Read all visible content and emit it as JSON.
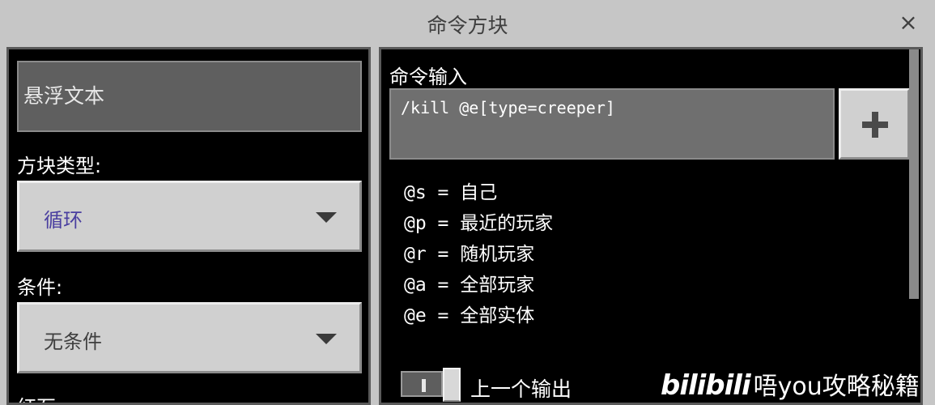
{
  "window": {
    "title": "命令方块",
    "close_label": "×"
  },
  "left_panel": {
    "hover_text_placeholder": "悬浮文本",
    "block_type_label": "方块类型:",
    "block_type_value": "循环",
    "conditional_label": "条件:",
    "conditional_value": "无条件",
    "redstone_label": "红石:"
  },
  "right_panel": {
    "command_input_label": "命令输入",
    "command_value": "/kill @e[type=creeper]",
    "add_button_icon": "plus-icon",
    "selectors": [
      "@s = 自己",
      "@p = 最近的玩家",
      "@r = 随机玩家",
      "@a = 全部玩家",
      "@e = 全部实体"
    ],
    "previous_output_label": "上一个输出",
    "previous_output_enabled": true
  },
  "watermark": {
    "logo": "bilibili",
    "text": "唔you攻略秘籍"
  },
  "colors": {
    "window_bg": "#c6c6c6",
    "panel_bg": "#000000",
    "block_type_text": "#4a3fa0",
    "conditional_text": "#3f3f3f"
  }
}
